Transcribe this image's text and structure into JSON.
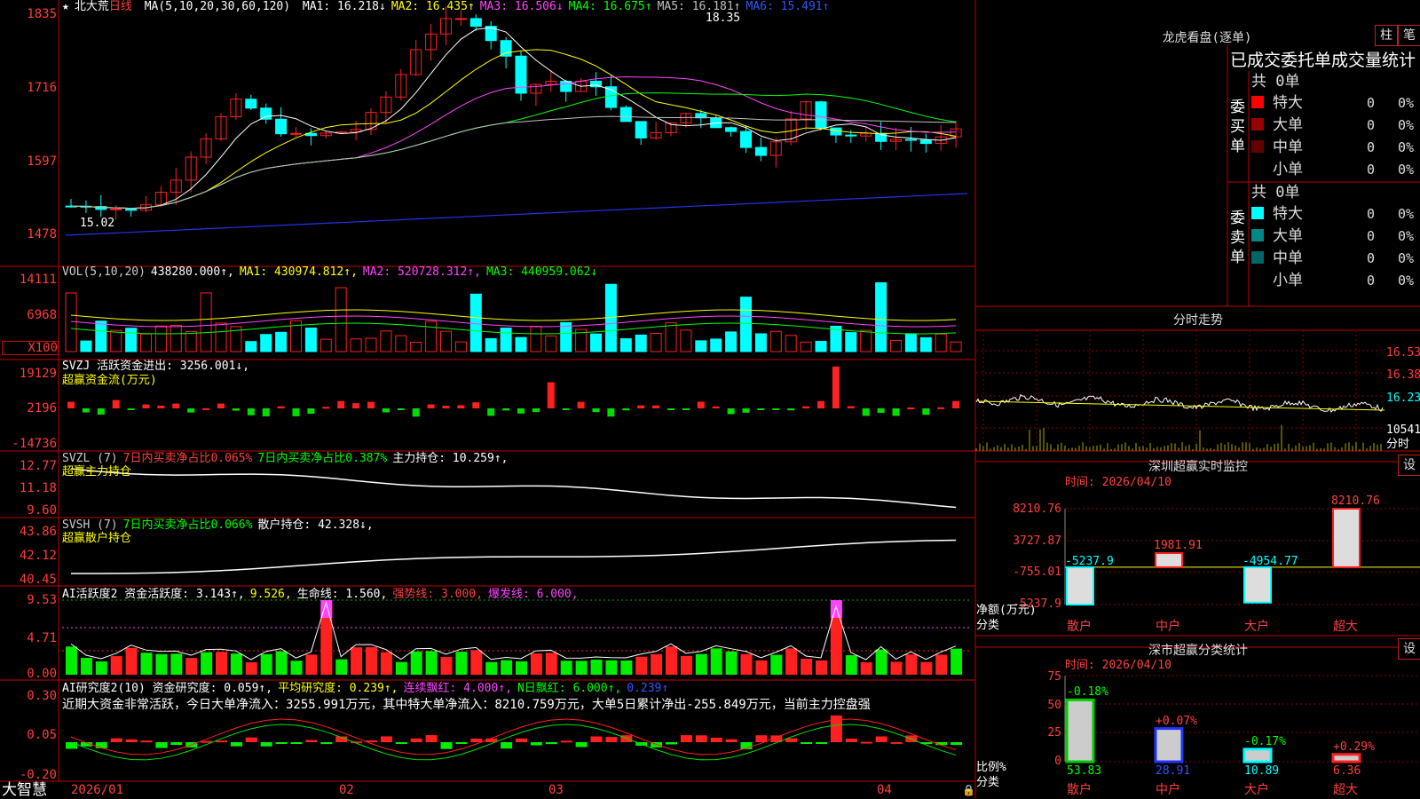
{
  "brand": "大智慧",
  "stock": {
    "star": "★",
    "name": "北大荒",
    "period": "日线"
  },
  "main": {
    "ma_label": "MA(5,10,20,30,60,120)",
    "ma": [
      {
        "text": "MA1: 16.218↓",
        "color": "#ffffff"
      },
      {
        "text": "MA2: 16.435↑",
        "color": "#ffff00"
      },
      {
        "text": "MA3: 16.506↓",
        "color": "#ff44ff"
      },
      {
        "text": "MA4: 16.675↑",
        "color": "#00ff00"
      },
      {
        "text": "MA5: 16.181↑",
        "color": "#c0c0c0"
      },
      {
        "text": "MA6: 15.491↑",
        "color": "#3355ff"
      }
    ],
    "y_labels": [
      "1835",
      "1716",
      "1597",
      "1478"
    ],
    "high_mark": "18.35",
    "low_mark": "15.02"
  },
  "vol": {
    "header": [
      {
        "text": "VOL(5,10,20)",
        "color": "#cccccc"
      },
      {
        "text": "438280.000↑,",
        "color": "#ffffff"
      },
      {
        "text": "MA1: 430974.812↑,",
        "color": "#ffff00"
      },
      {
        "text": "MA2: 520728.312↑,",
        "color": "#ff44ff"
      },
      {
        "text": "MA3: 440959.062↓",
        "color": "#00ff00"
      }
    ],
    "y_labels": [
      "14111",
      "6968",
      "X100"
    ]
  },
  "svzj": {
    "header": [
      {
        "text": "SVZJ  活跃资金进出: 3256.001↓,",
        "color": "#ffffff"
      }
    ],
    "sub": "超赢资金流(万元)",
    "y_labels": [
      "19129",
      "2196",
      "-14736"
    ]
  },
  "svzl": {
    "header": [
      {
        "text": "SVZL (7)",
        "color": "#cccccc"
      },
      {
        "text": "7日内买卖净占比0.065%",
        "color": "#ff4040"
      },
      {
        "text": "7日内买卖净占比0.387%",
        "color": "#00ff00"
      },
      {
        "text": "主力持仓: 10.259↑,",
        "color": "#ffffff"
      }
    ],
    "sub": "超赢主力持仓",
    "y_labels": [
      "12.77",
      "11.18",
      "9.60"
    ]
  },
  "svsh": {
    "header": [
      {
        "text": "SVSH (7)",
        "color": "#cccccc"
      },
      {
        "text": "7日内买卖净占比0.066%",
        "color": "#00ff00"
      },
      {
        "text": "散户持仓: 42.328↓,",
        "color": "#ffffff"
      }
    ],
    "sub": "超赢散户持仓",
    "y_labels": [
      "43.86",
      "42.12",
      "40.45"
    ]
  },
  "ai1": {
    "header": [
      {
        "text": "AI活跃度2 资金活跃度: 3.143↑,",
        "color": "#ffffff"
      },
      {
        "text": "9.526,",
        "color": "#ffff00"
      },
      {
        "text": "生命线: 1.560,",
        "color": "#ffffff"
      },
      {
        "text": "强势线: 3.000,",
        "color": "#ff4040"
      },
      {
        "text": "爆发线: 6.000,",
        "color": "#ff44ff"
      }
    ],
    "y_labels": [
      "9.53",
      "4.71",
      "0.00"
    ]
  },
  "ai2": {
    "header": [
      {
        "text": "AI研究度2(10) 资金研究度: 0.059↑,",
        "color": "#ffffff"
      },
      {
        "text": "平均研究度: 0.239↑,",
        "color": "#ffff00"
      },
      {
        "text": "连续飘红: 4.000↑,",
        "color": "#ff44ff"
      },
      {
        "text": "N日飘红: 6.000↑,",
        "color": "#00ff00"
      },
      {
        "text": "0.239↑",
        "color": "#3355ff"
      }
    ],
    "comment": "近期大资金非常活跃，今日大单净流入：3255.991万元，其中特大单净流入：8210.759万元，大单5日累计净出-255.849万元，当前主力控盘强",
    "y_labels": [
      "0.30",
      "0.05",
      "-0.20"
    ]
  },
  "x_labels": [
    "2026/01",
    "02",
    "03",
    "04"
  ],
  "lhb": {
    "title": "龙虎看盘(逐单)",
    "btn_col": "柱",
    "btn_bi": "笔",
    "subtitle": "已成交委托单成交量统计",
    "buy": {
      "label": "委买单",
      "total": "共 0单",
      "rows": [
        {
          "name": "特大",
          "v": "0",
          "p": "0%",
          "color": "#ff0000"
        },
        {
          "name": "大单",
          "v": "0",
          "p": "0%",
          "color": "#990000"
        },
        {
          "name": "中单",
          "v": "0",
          "p": "0%",
          "color": "#660000"
        },
        {
          "name": "小单",
          "v": "0",
          "p": "0%",
          "color": ""
        }
      ]
    },
    "sell": {
      "label": "委卖单",
      "total": "共 0单",
      "rows": [
        {
          "name": "特大",
          "v": "0",
          "p": "0%",
          "color": "#00ffff"
        },
        {
          "name": "大单",
          "v": "0",
          "p": "0%",
          "color": "#008888"
        },
        {
          "name": "中单",
          "v": "0",
          "p": "0%",
          "color": "#006666"
        },
        {
          "name": "小单",
          "v": "0",
          "p": "0%",
          "color": ""
        }
      ]
    }
  },
  "fenshi": {
    "title": "分时走势",
    "y_labels": [
      "16.53",
      "16.38",
      "16.23",
      "10541"
    ],
    "foot": "分时"
  },
  "szjk": {
    "title": "深圳超赢实时监控",
    "btn": "设",
    "date": "时间: 2026/04/10",
    "y_labels": [
      "8210.76",
      "3727.87",
      "-755.01",
      "-5237.9"
    ],
    "left1": "净额(万元)",
    "left2": "分类",
    "chart_data": {
      "type": "bar",
      "categories": [
        "散户",
        "中户",
        "大户",
        "超大"
      ],
      "values": [
        -5237.9,
        1981.91,
        -4954.77,
        8210.76
      ],
      "ylim": [
        -5237.9,
        8210.76
      ]
    },
    "value_labels": [
      "-5237.9",
      "1981.91",
      "-4954.77",
      "8210.76"
    ]
  },
  "scfl": {
    "title": "深市超赢分类统计",
    "btn": "设",
    "date": "时间: 2026/04/10",
    "y_labels": [
      "75",
      "50",
      "25",
      "0"
    ],
    "left1": "比例%",
    "left2": "分类",
    "chart_data": {
      "type": "bar",
      "categories": [
        "散户",
        "中户",
        "大户",
        "超大"
      ],
      "values": [
        53.83,
        28.91,
        10.89,
        6.36
      ],
      "changes": [
        "-0.18%",
        "+0.07%",
        "-0.17%",
        "+0.29%"
      ],
      "ylim": [
        0,
        75
      ]
    },
    "value_labels": [
      "53.83",
      "28.91",
      "10.89",
      "6.36"
    ]
  }
}
